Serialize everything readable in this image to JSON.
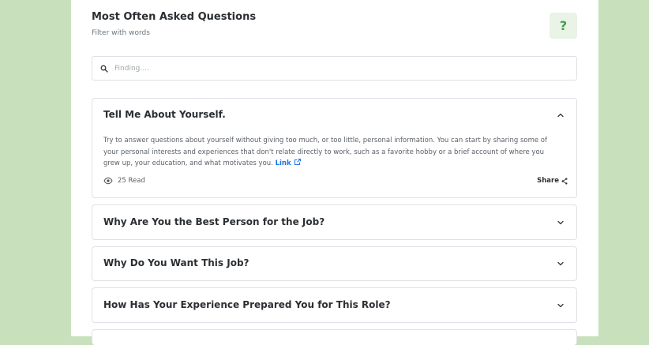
{
  "header": {
    "title": "Most Often Asked Questions",
    "subtitle": "Filter with words",
    "help_icon": "?"
  },
  "search": {
    "placeholder": "Finding...."
  },
  "faqs": [
    {
      "question": "Tell Me About Yourself.",
      "expanded": true,
      "answer": "Try to answer questions about yourself without giving too much, or too little, personal information. You can start by sharing some of your personal interests and experiences that don't relate directly to work, such as a favorite hobby or a brief account of where you grew up, your education, and what motivates you.",
      "link_label": "Link",
      "reads": "25 Read",
      "share_label": "Share"
    },
    {
      "question": "Why Are You the Best Person for the Job?",
      "expanded": false
    },
    {
      "question": "Why Do You Want This Job?",
      "expanded": false
    },
    {
      "question": "How Has Your Experience Prepared You for This Role?",
      "expanded": false
    }
  ],
  "colors": {
    "page_background": "#c8e0bb",
    "accent_green": "#43a047",
    "link_blue": "#1a73e8"
  }
}
